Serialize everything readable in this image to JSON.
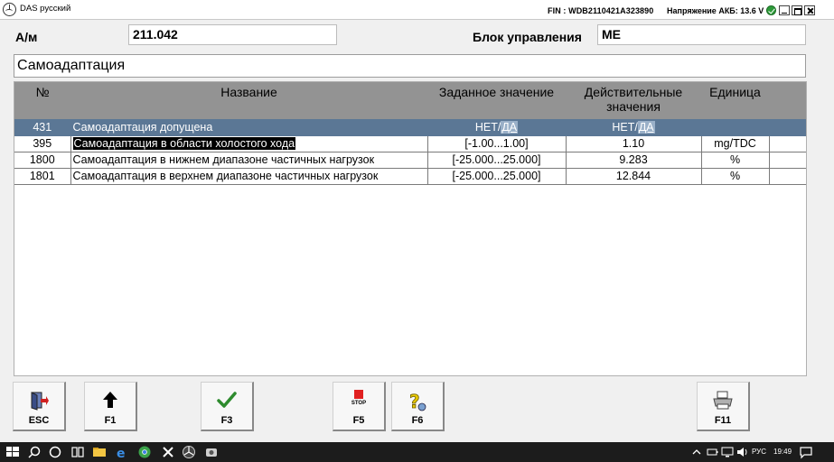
{
  "window": {
    "title": "DAS русский",
    "fin": "FIN : WDB2110421A323890",
    "battery_voltage": "Напряжение АКБ: 13.6 V"
  },
  "header": {
    "am_label": "А/м",
    "am_value": "211.042",
    "ecu_label": "Блок управления",
    "ecu_value": "ME"
  },
  "section_title": "Самоадаптация",
  "table": {
    "columns": [
      "№",
      "Название",
      "Заданное значение",
      "Действительные значения",
      "Единица"
    ],
    "rows": [
      {
        "num": "431",
        "name": "Самоадаптация допущена",
        "target_no": "НЕТ",
        "target_sep": "/",
        "target_yes": "ДА",
        "actual_no": "НЕТ",
        "actual_sep": "/",
        "actual_yes": "ДА",
        "unit": ""
      },
      {
        "num": "395",
        "name": "Самоадаптация в области холостого хода",
        "target": "[-1.00...1.00]",
        "actual": "1.10",
        "unit": "mg/TDC"
      },
      {
        "num": "1800",
        "name": "Самоадаптация в нижнем диапазоне частичных нагрузок",
        "target": "[-25.000...25.000]",
        "actual": "9.283",
        "unit": "%"
      },
      {
        "num": "1801",
        "name": "Самоадаптация в верхнем диапазоне частичных нагрузок",
        "target": "[-25.000...25.000]",
        "actual": "12.844",
        "unit": "%"
      }
    ]
  },
  "toolbar": {
    "esc": "ESC",
    "f1": "F1",
    "f3": "F3",
    "f5": "F5",
    "f5_stop": "STOP",
    "f6": "F6",
    "f11": "F11"
  },
  "taskbar": {
    "lang": "РУС",
    "time": "19:49"
  },
  "colors": {
    "header_gray": "#939393",
    "selected_row": "#5b7795",
    "check_green": "#2e9b3a",
    "stop_red": "#e02020"
  }
}
